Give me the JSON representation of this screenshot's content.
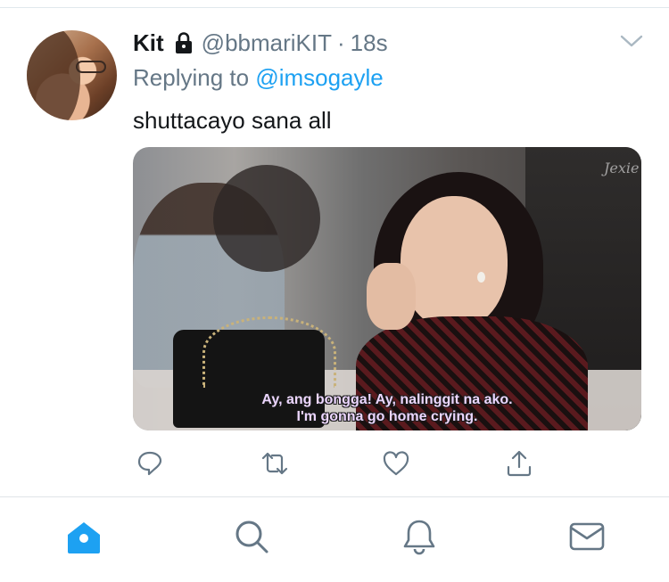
{
  "tweet": {
    "display_name": "Kit",
    "handle": "@bbmariKIT",
    "separator": "·",
    "timestamp": "18s",
    "replying_prefix": "Replying to",
    "replying_to": "@imsogayle",
    "text": "shuttacayo sana all",
    "media": {
      "watermark": "Jexie",
      "subtitle_line1": "Ay, ang bongga! Ay, nalinggit na ako.",
      "subtitle_line2": "I'm gonna go home crying."
    }
  },
  "icons": {
    "lock": "lock-icon",
    "menu": "chevron-down-icon",
    "reply": "reply-icon",
    "retweet": "retweet-icon",
    "like": "heart-icon",
    "share": "share-icon",
    "home": "home-icon",
    "search": "search-icon",
    "notifications": "bell-icon",
    "messages": "mail-icon"
  },
  "colors": {
    "accent": "#1da1f2",
    "secondary_text": "#657786",
    "icon_gray": "#657786"
  }
}
